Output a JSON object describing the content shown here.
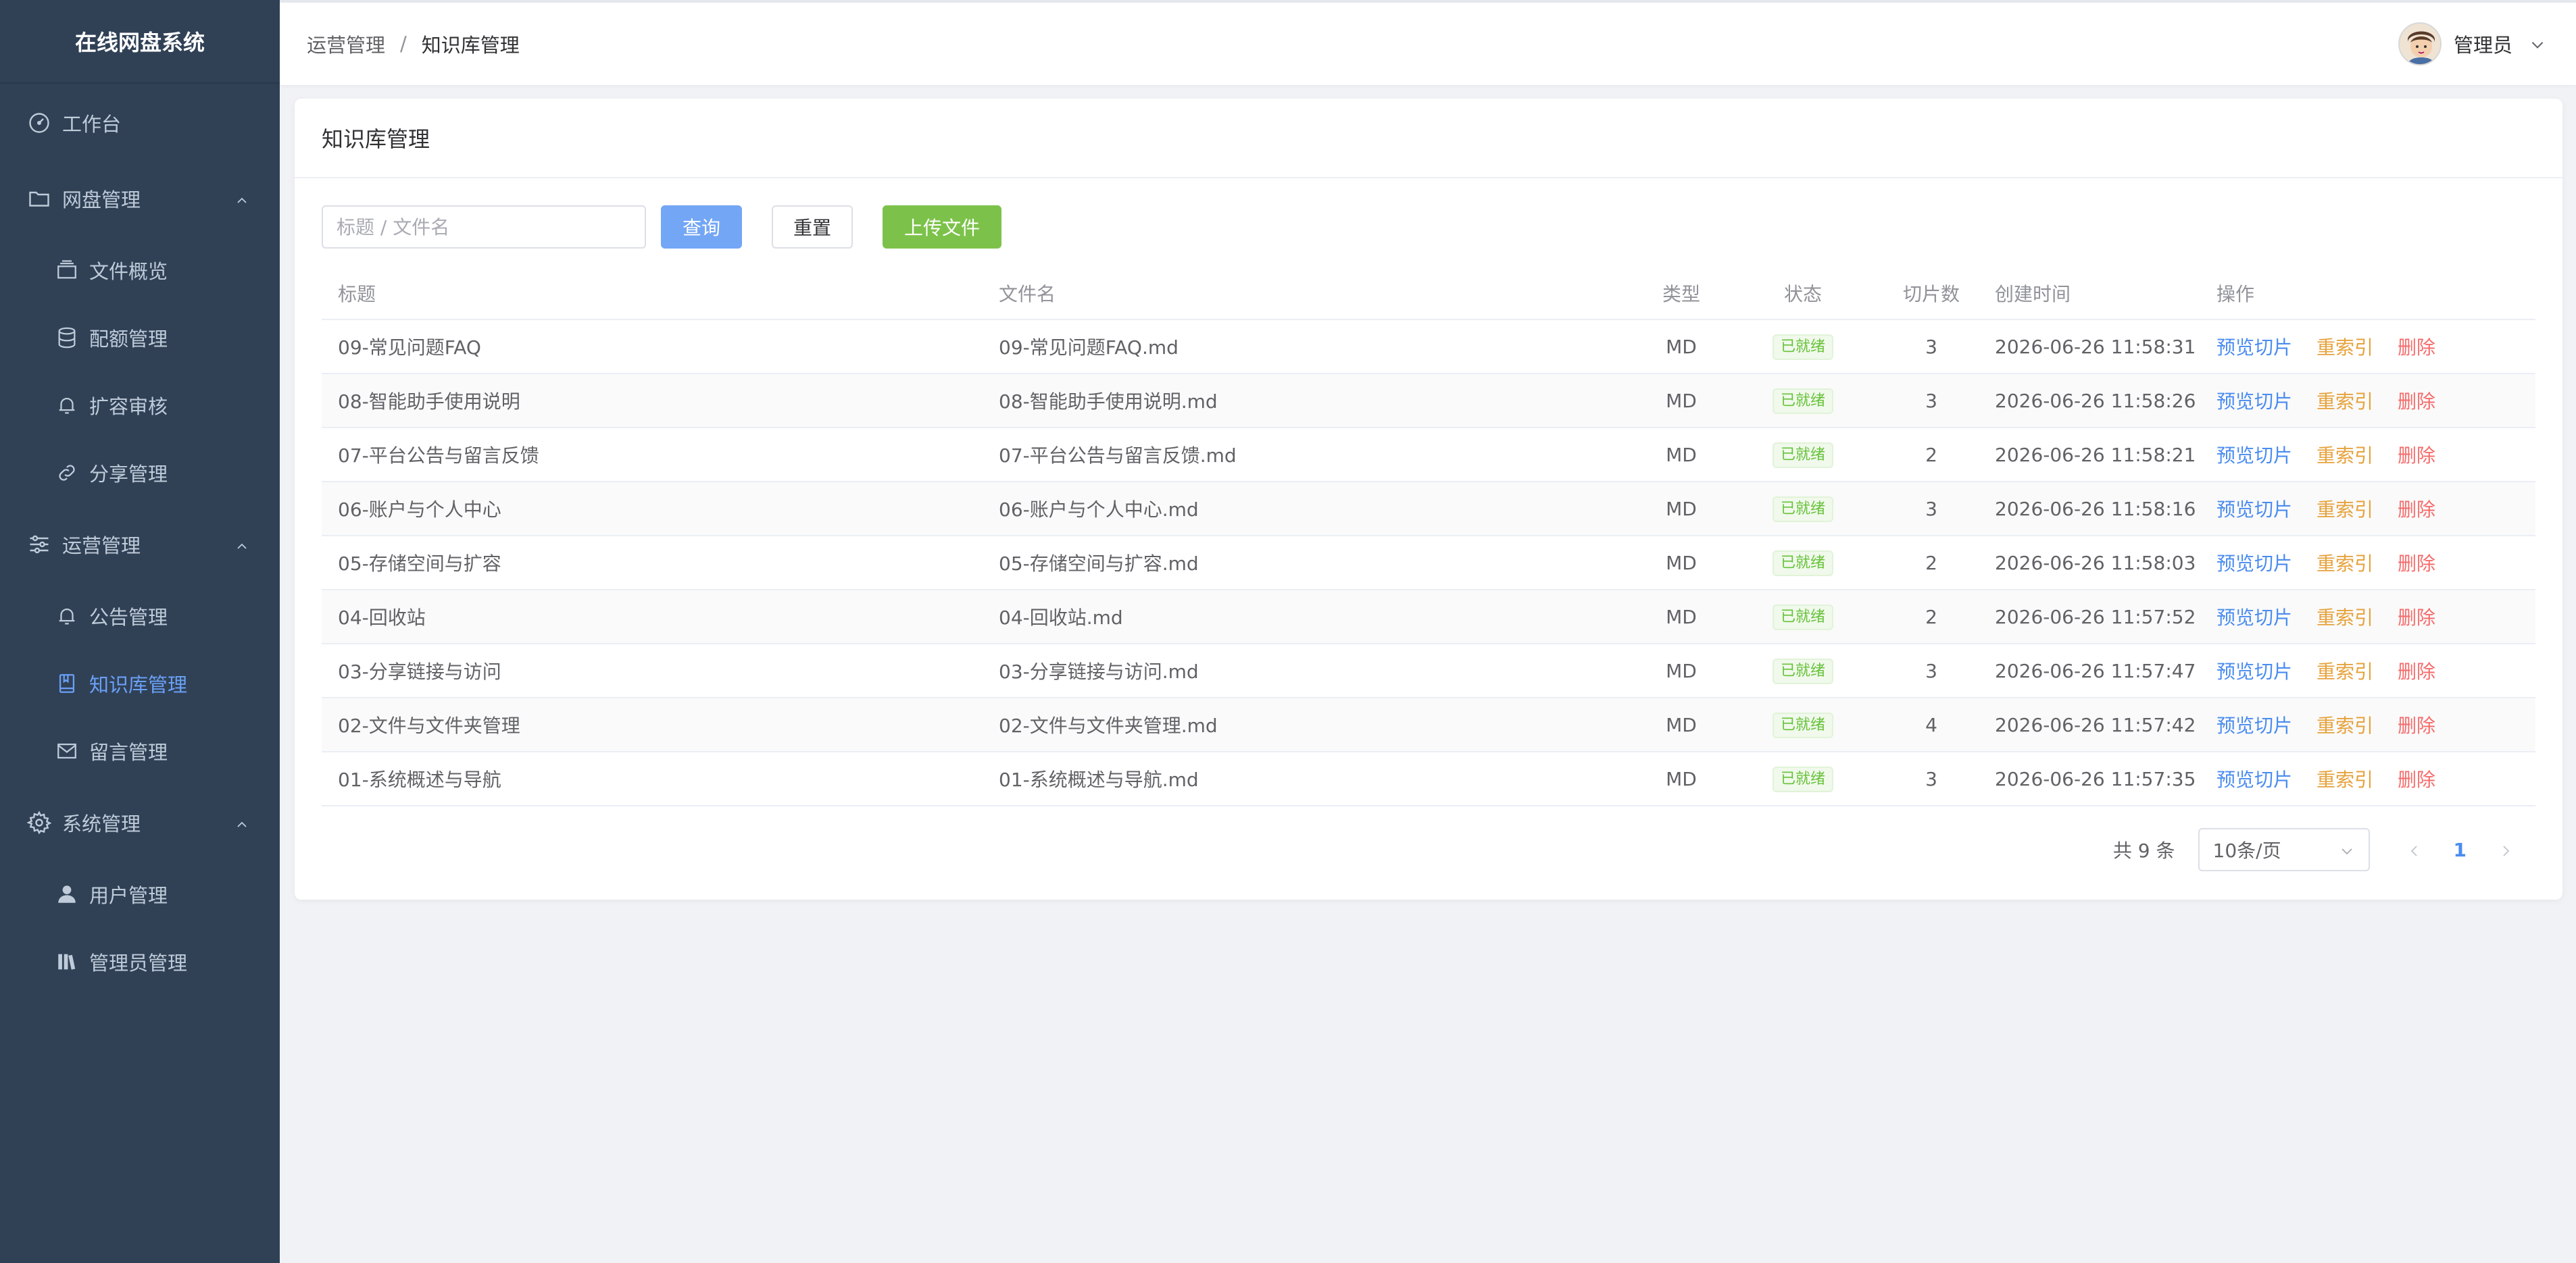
{
  "app": {
    "title": "在线网盘系统"
  },
  "sidebar": {
    "workbench": "工作台",
    "groups": [
      {
        "label": "网盘管理",
        "items": [
          "文件概览",
          "配额管理",
          "扩容审核",
          "分享管理"
        ]
      },
      {
        "label": "运营管理",
        "items": [
          "公告管理",
          "知识库管理",
          "留言管理"
        ]
      },
      {
        "label": "系统管理",
        "items": [
          "用户管理",
          "管理员管理"
        ]
      }
    ],
    "active_item": "知识库管理"
  },
  "header": {
    "breadcrumb": [
      "运营管理",
      "知识库管理"
    ],
    "breadcrumb_sep": "/",
    "user_name": "管理员"
  },
  "card": {
    "title": "知识库管理"
  },
  "toolbar": {
    "search_placeholder": "标题 / 文件名",
    "query_label": "查询",
    "reset_label": "重置",
    "upload_label": "上传文件"
  },
  "table": {
    "columns": [
      "标题",
      "文件名",
      "类型",
      "状态",
      "切片数",
      "创建时间",
      "操作"
    ],
    "actions": {
      "preview": "预览切片",
      "reindex": "重索引",
      "delete": "删除"
    },
    "rows": [
      {
        "title": "09-常见问题FAQ",
        "file": "09-常见问题FAQ.md",
        "type": "MD",
        "status": "已就绪",
        "count": "3",
        "time": "2026-06-26 11:58:31"
      },
      {
        "title": "08-智能助手使用说明",
        "file": "08-智能助手使用说明.md",
        "type": "MD",
        "status": "已就绪",
        "count": "3",
        "time": "2026-06-26 11:58:26"
      },
      {
        "title": "07-平台公告与留言反馈",
        "file": "07-平台公告与留言反馈.md",
        "type": "MD",
        "status": "已就绪",
        "count": "2",
        "time": "2026-06-26 11:58:21"
      },
      {
        "title": "06-账户与个人中心",
        "file": "06-账户与个人中心.md",
        "type": "MD",
        "status": "已就绪",
        "count": "3",
        "time": "2026-06-26 11:58:16"
      },
      {
        "title": "05-存储空间与扩容",
        "file": "05-存储空间与扩容.md",
        "type": "MD",
        "status": "已就绪",
        "count": "2",
        "time": "2026-06-26 11:58:03"
      },
      {
        "title": "04-回收站",
        "file": "04-回收站.md",
        "type": "MD",
        "status": "已就绪",
        "count": "2",
        "time": "2026-06-26 11:57:52"
      },
      {
        "title": "03-分享链接与访问",
        "file": "03-分享链接与访问.md",
        "type": "MD",
        "status": "已就绪",
        "count": "3",
        "time": "2026-06-26 11:57:47"
      },
      {
        "title": "02-文件与文件夹管理",
        "file": "02-文件与文件夹管理.md",
        "type": "MD",
        "status": "已就绪",
        "count": "4",
        "time": "2026-06-26 11:57:42"
      },
      {
        "title": "01-系统概述与导航",
        "file": "01-系统概述与导航.md",
        "type": "MD",
        "status": "已就绪",
        "count": "3",
        "time": "2026-06-26 11:57:35"
      }
    ]
  },
  "pagination": {
    "total_text": "共 9 条",
    "page_size": "10条/页",
    "current_page": "1"
  },
  "colors": {
    "sidebar_bg": "#304156",
    "active": "#6aa0f5",
    "primary_button": "#73a6f5",
    "success_button": "#7cc24a",
    "link_blue": "#4a8cf0",
    "link_orange": "#e6a23c",
    "link_red": "#f56c6c",
    "status_green": "#67c23a"
  }
}
